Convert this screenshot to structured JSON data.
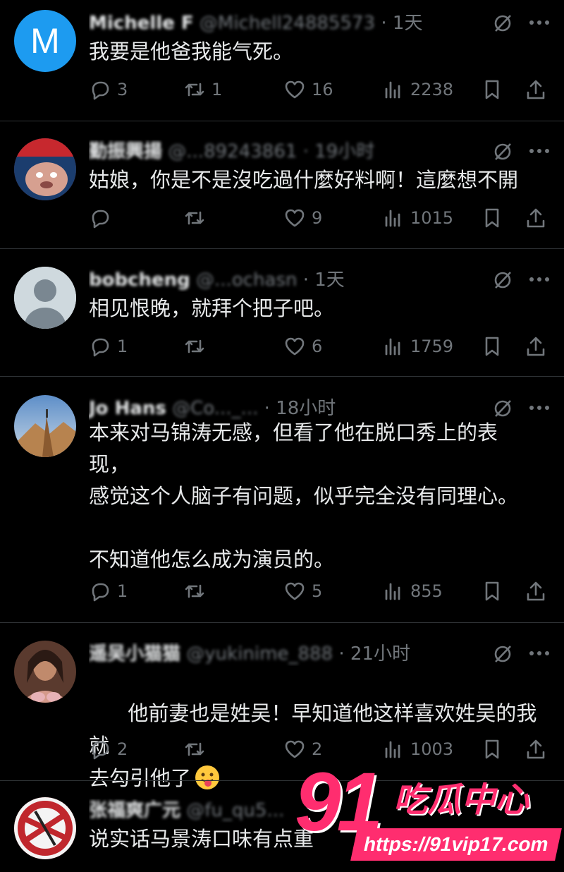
{
  "posts": [
    {
      "avatar_letter": "M",
      "avatar_color": "#1d9bf0",
      "name": "Michelle F",
      "handle": "@Michell24885573",
      "time": "1天",
      "text": "我要是他爸我能气死。",
      "replies": "3",
      "retweets": "1",
      "likes": "16",
      "views": "2238"
    },
    {
      "avatar_letter": "",
      "avatar_color": "#7a2a2a",
      "name": "勤振興揚",
      "handle": "@...89243861",
      "time": "19小时",
      "text": "姑娘，你是不是沒吃過什麼好料啊！這麼想不開",
      "replies": "",
      "retweets": "",
      "likes": "9",
      "views": "1015"
    },
    {
      "avatar_letter": "",
      "avatar_color": "#cfd9de",
      "name": "bobcheng",
      "handle": "@...ochasn",
      "time": "1天",
      "text": "相见恨晚，就拜个把子吧。",
      "replies": "1",
      "retweets": "",
      "likes": "6",
      "views": "1759"
    },
    {
      "avatar_letter": "",
      "avatar_color": "#6a8fb8",
      "name": "Jo Hans",
      "handle": "@Co..._...",
      "time": "18小时",
      "text": "本来对马锦涛无感，但看了他在脱口秀上的表\n现，\n感觉这个人脑子有问题，似乎完全没有同理心。\n\n不知道他怎么成为演员的。",
      "replies": "1",
      "retweets": "",
      "likes": "5",
      "views": "855"
    },
    {
      "avatar_letter": "",
      "avatar_color": "#a36a55",
      "name": "遥吴小猫猫",
      "handle": "@yukinime_888",
      "time": "21小时",
      "text": "他前妻也是姓吴！早知道他这样喜欢姓吴的我就\n去勾引他了",
      "replies": "2",
      "retweets": "",
      "likes": "2",
      "views": "1003"
    },
    {
      "avatar_letter": "",
      "avatar_color": "#c0272d",
      "name": "张福爽广元",
      "handle": "@fu_qu5...",
      "time": "",
      "text": "说实话马景涛口味有点重",
      "replies": "",
      "retweets": "",
      "likes": "",
      "views": ""
    }
  ],
  "watermark": {
    "number": "91",
    "brand": "吃瓜中心",
    "url": "https://91vip17.com"
  },
  "colors": {
    "background": "#000000",
    "text": "#e7e9ea",
    "muted": "#71767b",
    "divider": "#2f3336",
    "accent_pink": "#ff2d6f"
  },
  "icons": [
    "reply-icon",
    "retweet-icon",
    "like-icon",
    "views-icon",
    "bookmark-icon",
    "share-icon",
    "grok-icon",
    "more-icon"
  ]
}
